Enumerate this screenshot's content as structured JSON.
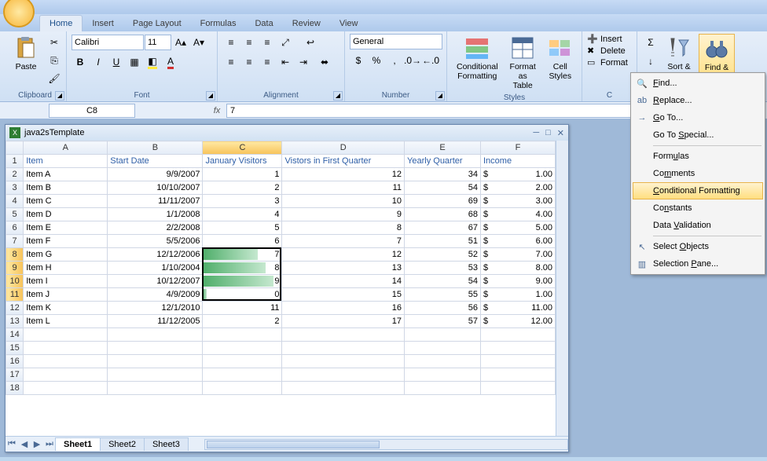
{
  "tabs": [
    "Home",
    "Insert",
    "Page Layout",
    "Formulas",
    "Data",
    "Review",
    "View"
  ],
  "active_tab": "Home",
  "ribbon": {
    "clipboard": {
      "label": "Clipboard",
      "paste": "Paste"
    },
    "font": {
      "label": "Font",
      "family": "Calibri",
      "size": "11"
    },
    "alignment": {
      "label": "Alignment"
    },
    "number": {
      "label": "Number",
      "format": "General"
    },
    "styles": {
      "label": "Styles",
      "cond": "Conditional\nFormatting",
      "table": "Format\nas Table",
      "cell": "Cell\nStyles"
    },
    "cells": {
      "label": "C",
      "insert": "Insert",
      "delete": "Delete",
      "format": "Format"
    },
    "editing": {
      "sort": "Sort &\nFilter",
      "find": "Find &\nSelect"
    }
  },
  "namebox": "C8",
  "formula": "7",
  "workbook": "java2sTemplate",
  "columns": [
    "A",
    "B",
    "C",
    "D",
    "E",
    "F"
  ],
  "headers": [
    "Item",
    "Start Date",
    "January Visitors",
    "Vistors in First Quarter",
    "Yearly Quarter",
    "Income"
  ],
  "rows": [
    {
      "a": "Item A",
      "b": "9/9/2007",
      "c": "1",
      "d": "12",
      "e": "34",
      "f": "1.00"
    },
    {
      "a": "Item B",
      "b": "10/10/2007",
      "c": "2",
      "d": "11",
      "e": "54",
      "f": "2.00"
    },
    {
      "a": "Item C",
      "b": "11/11/2007",
      "c": "3",
      "d": "10",
      "e": "69",
      "f": "3.00"
    },
    {
      "a": "Item D",
      "b": "1/1/2008",
      "c": "4",
      "d": "9",
      "e": "68",
      "f": "4.00"
    },
    {
      "a": "Item E",
      "b": "2/2/2008",
      "c": "5",
      "d": "8",
      "e": "67",
      "f": "5.00"
    },
    {
      "a": "Item F",
      "b": "5/5/2006",
      "c": "6",
      "d": "7",
      "e": "51",
      "f": "6.00"
    },
    {
      "a": "Item G",
      "b": "12/12/2006",
      "c": "7",
      "d": "12",
      "e": "52",
      "f": "7.00"
    },
    {
      "a": "Item H",
      "b": "1/10/2004",
      "c": "8",
      "d": "13",
      "e": "53",
      "f": "8.00"
    },
    {
      "a": "Item I",
      "b": "10/12/2007",
      "c": "9",
      "d": "14",
      "e": "54",
      "f": "9.00"
    },
    {
      "a": "Item J",
      "b": "4/9/2009",
      "c": "0",
      "d": "15",
      "e": "55",
      "f": "1.00"
    },
    {
      "a": "Item K",
      "b": "12/1/2010",
      "c": "11",
      "d": "16",
      "e": "56",
      "f": "11.00"
    },
    {
      "a": "Item L",
      "b": "11/12/2005",
      "c": "2",
      "d": "17",
      "e": "57",
      "f": "12.00"
    }
  ],
  "databars": [
    70,
    80,
    90,
    5
  ],
  "sheets": [
    "Sheet1",
    "Sheet2",
    "Sheet3"
  ],
  "active_sheet": "Sheet1",
  "menu": {
    "find": "Find...",
    "replace": "Replace...",
    "goto": "Go To...",
    "special": "Go To Special...",
    "formulas": "Formulas",
    "comments": "Comments",
    "cond": "Conditional Formatting",
    "constants": "Constants",
    "validation": "Data Validation",
    "select_obj": "Select Objects",
    "sel_pane": "Selection Pane..."
  }
}
